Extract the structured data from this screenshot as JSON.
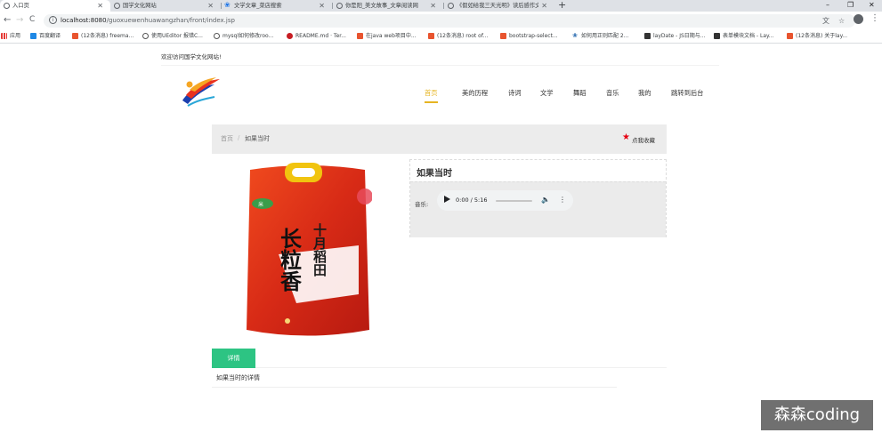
{
  "browser": {
    "tabs": [
      {
        "title": "入口页",
        "active": true
      },
      {
        "title": "国学文化网站",
        "active": false
      },
      {
        "title": "文学文章_菜店搜索",
        "active": false
      },
      {
        "title": "你是阳_美文故事_文章阅读网",
        "active": false
      },
      {
        "title": "《假如给我三天光明》读后感作文",
        "active": false
      }
    ],
    "new_tab": "+",
    "window_controls": {
      "minimize": "–",
      "maximize": "❐",
      "close": "✕"
    },
    "nav": {
      "back": "←",
      "forward": "→",
      "reload": "C"
    },
    "url_host": "localhost:8080",
    "url_path": "/guoxuewenhuawangzhan/front/index.jsp",
    "bookmarks": [
      {
        "label": "应用",
        "color": "#e53935"
      },
      {
        "label": "百度翻译",
        "color": "#1e88e5"
      },
      {
        "label": "(12条消息) freema...",
        "color": "#e8542f"
      },
      {
        "label": "使用UEditor 报错C...",
        "color": "#555555"
      },
      {
        "label": "mysql如何修改roo...",
        "color": "#555555"
      },
      {
        "label": "README.md · Ter...",
        "color": "#c71d23"
      },
      {
        "label": "在java web项目中...",
        "color": "#e8542f"
      },
      {
        "label": "(12条消息) root of...",
        "color": "#e8542f"
      },
      {
        "label": "bootstrap-select...",
        "color": "#e8542f"
      },
      {
        "label": "如何用正则匹配 2...",
        "color": "#2b6cb0"
      },
      {
        "label": "layDate - JS日期与...",
        "color": "#333333"
      },
      {
        "label": "表单模块文档 - Lay...",
        "color": "#333333"
      },
      {
        "label": "(12条消息) 关于lay...",
        "color": "#e8542f"
      }
    ]
  },
  "site": {
    "welcome": "欢迎访问国学文化网站!",
    "nav": [
      "首页",
      "美的历程",
      "诗词",
      "文学",
      "舞蹈",
      "音乐",
      "我的",
      "跳转到后台"
    ],
    "active_nav": "首页",
    "accent": "#e6b422"
  },
  "breadcrumb": {
    "home": "首页",
    "sep": "/",
    "current": "如果当时"
  },
  "favorite": {
    "icon": "★",
    "label": "点我收藏"
  },
  "detail": {
    "title": "如果当时",
    "music_label": "音乐:",
    "audio_time": "0:00 / 5:16"
  },
  "product_image": {
    "top_text": "十月稻田",
    "main_text": "长粒香",
    "logo_text": "米"
  },
  "tabs": {
    "detail_label": "详情",
    "accent": "#2dc483"
  },
  "content": {
    "text": "如果当时的详情"
  },
  "watermark": "森森coding"
}
